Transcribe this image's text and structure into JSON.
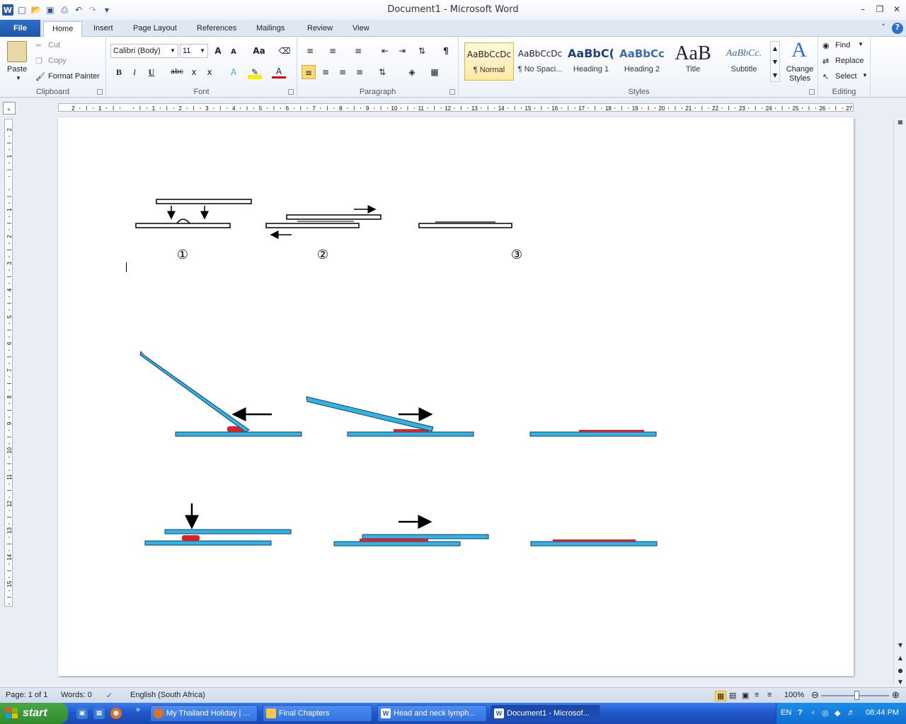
{
  "window": {
    "title": "Document1  -  Microsoft Word",
    "app_icon": "W"
  },
  "quick_access": [
    "word-icon",
    "new-doc-icon",
    "open-icon",
    "save-icon",
    "print-preview-icon",
    "undo-icon",
    "redo-icon",
    "customize-icon"
  ],
  "tabs": [
    "File",
    "Home",
    "Insert",
    "Page Layout",
    "References",
    "Mailings",
    "Review",
    "View"
  ],
  "ribbon": {
    "clipboard": {
      "label": "Clipboard",
      "paste": "Paste",
      "cut": "Cut",
      "copy": "Copy",
      "format_painter": "Format Painter"
    },
    "font": {
      "label": "Font",
      "font_name": "Calibri (Body)",
      "font_size": "11",
      "grow": "A",
      "shrink": "A",
      "change_case": "Aa",
      "bold": "B",
      "italic": "I",
      "underline": "U",
      "strike": "abc",
      "subscript": "x",
      "superscript": "x",
      "font_color": "A"
    },
    "paragraph": {
      "label": "Paragraph",
      "pilcrow": "¶"
    },
    "styles": {
      "label": "Styles",
      "items": [
        {
          "sample": "AaBbCcDc",
          "name": "¶ Normal"
        },
        {
          "sample": "AaBbCcDc",
          "name": "¶ No Spaci..."
        },
        {
          "sample": "AaBbC(",
          "name": "Heading 1"
        },
        {
          "sample": "AaBbCc",
          "name": "Heading 2"
        },
        {
          "sample": "AaB",
          "name": "Title"
        },
        {
          "sample": "AaBbCc.",
          "name": "Subtitle"
        }
      ],
      "change_styles": "Change Styles"
    },
    "editing": {
      "label": "Editing",
      "find": "Find",
      "replace": "Replace",
      "select": "Select"
    }
  },
  "document": {
    "step_labels": [
      "①",
      "②",
      "③"
    ]
  },
  "statusbar": {
    "page": "Page: 1 of 1",
    "words": "Words: 0",
    "language": "English (South Africa)",
    "zoom": "100%",
    "zoom_level_percent": 100
  },
  "taskbar": {
    "start": "start",
    "tasks": [
      {
        "label": "My Thailand Holiday | ...",
        "icon": "firefox-icon"
      },
      {
        "label": "Final Chapters",
        "icon": "folder-icon"
      },
      {
        "label": "Head and neck lymph...",
        "icon": "word-icon"
      },
      {
        "label": "Document1 - Microsof...",
        "icon": "word-icon"
      }
    ],
    "language": "EN",
    "clock": "08:44 PM"
  },
  "colors": {
    "slide_blue": "#30b4e4",
    "specimen_red": "#e02020",
    "ribbon_file": "#2a64b8",
    "taskbar": "#2a62d8"
  }
}
